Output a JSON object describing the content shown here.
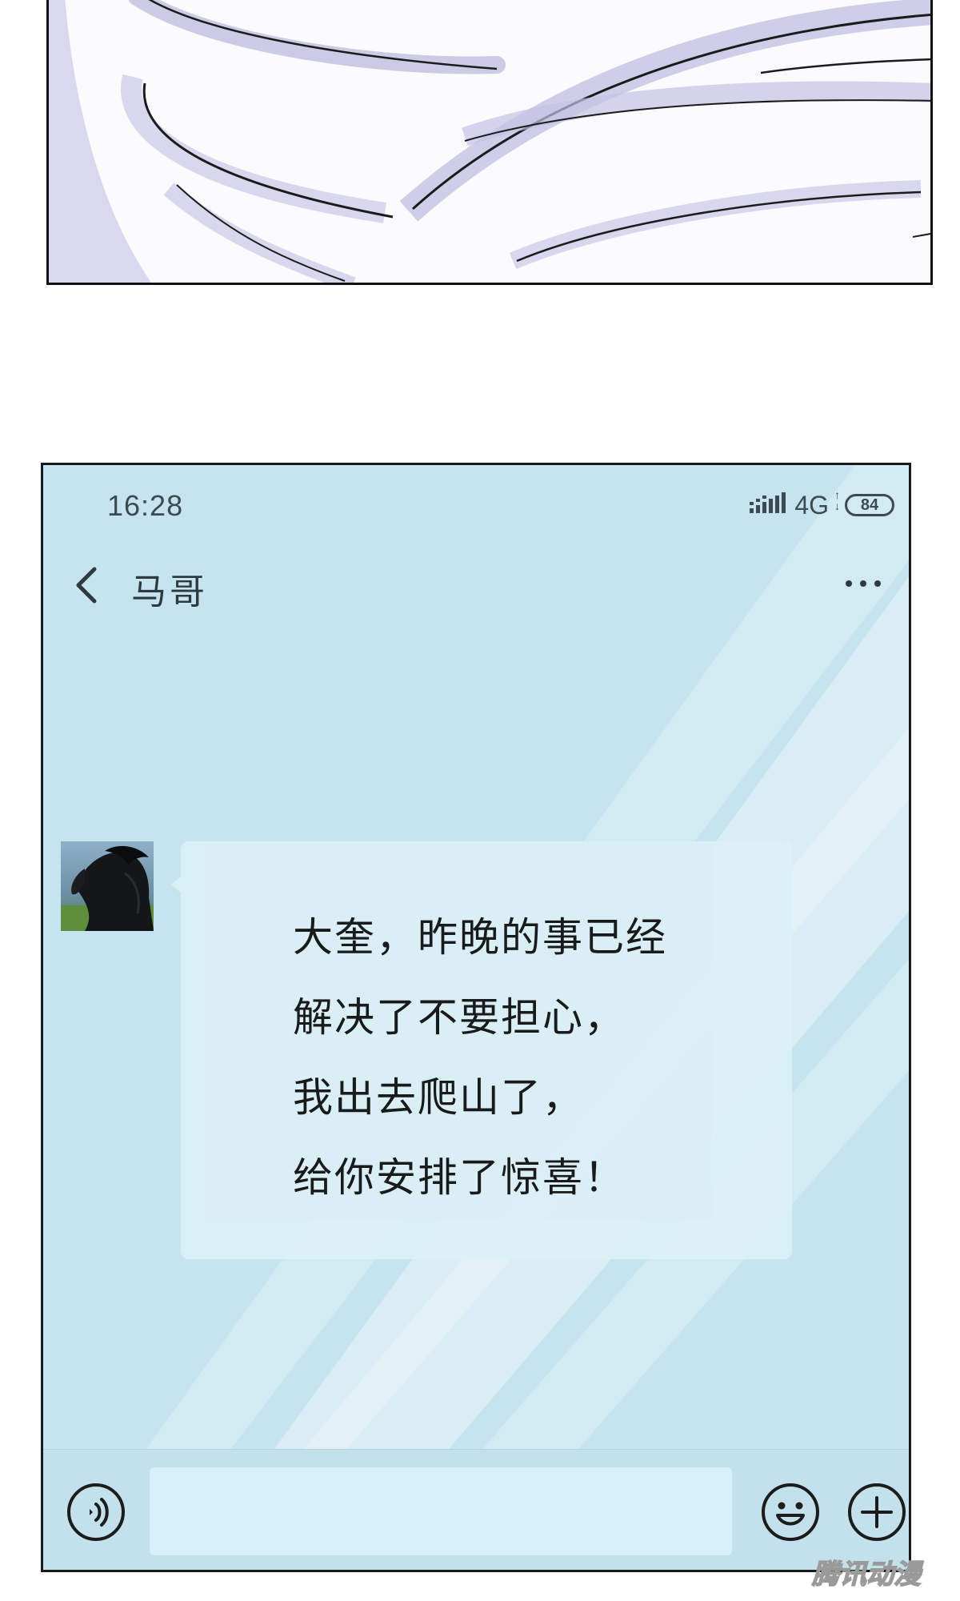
{
  "status_bar": {
    "time": "16:28",
    "network": "4G",
    "battery": "84"
  },
  "header": {
    "contact_name": "马哥"
  },
  "message": {
    "lines": [
      "大奎，昨晚的事已经",
      "解决了不要担心，",
      "我出去爬山了，",
      "给你安排了惊喜！"
    ]
  },
  "input_bar": {
    "placeholder": ""
  },
  "watermark": {
    "text": "腾讯动漫"
  },
  "icons": {
    "back": "chevron-left-icon",
    "more": "more-dots-icon",
    "voice": "voice-icon",
    "emoji": "emoji-icon",
    "plus": "plus-icon",
    "signal": "signal-bars-icon",
    "battery": "battery-icon"
  },
  "colors": {
    "chat_background": "#c6e4ef",
    "bubble": "#dbeff7",
    "input_bar": "#c2e1ec",
    "text": "#141414"
  }
}
